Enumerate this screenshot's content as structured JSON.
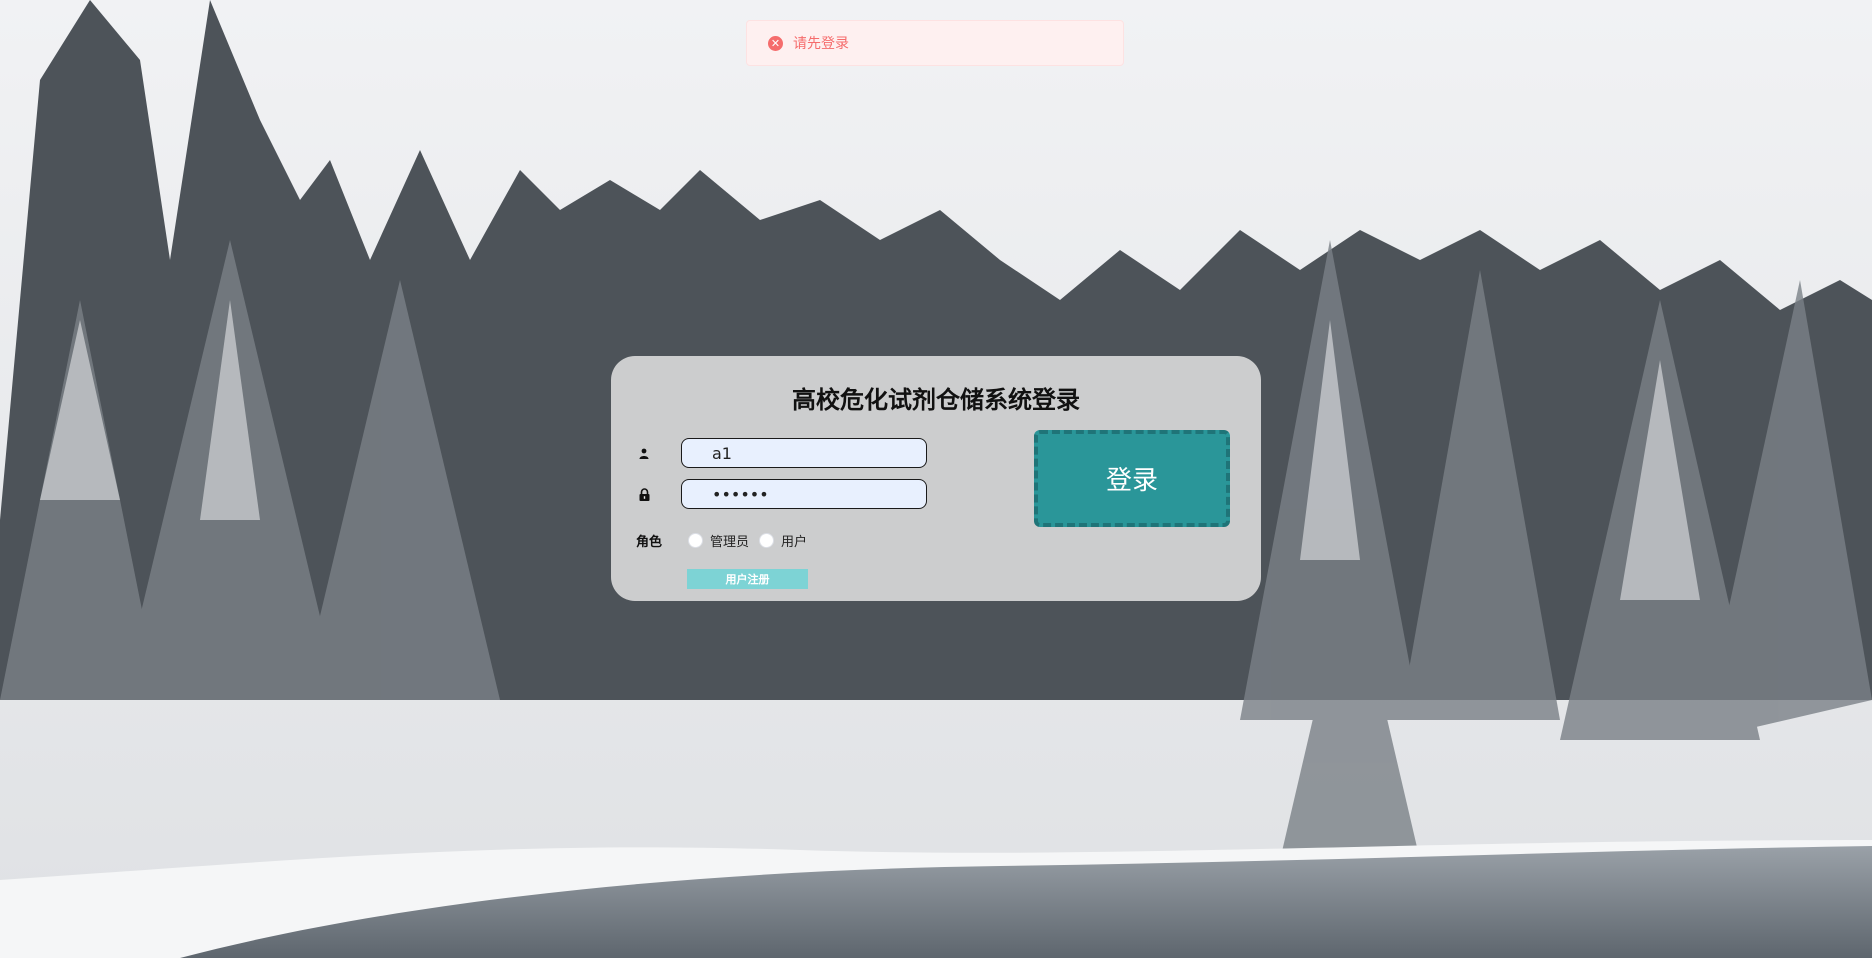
{
  "toast": {
    "icon": "error-circle-icon",
    "message": "请先登录",
    "color": "#f56c6c"
  },
  "login": {
    "title": "高校危化试剂仓储系统登录",
    "username_icon": "user-icon",
    "username_value": "a1",
    "password_icon": "lock-icon",
    "password_value": "••••••",
    "role_label": "角色",
    "roles": [
      "管理员",
      "用户"
    ],
    "register_label": "用户注册",
    "login_label": "登录",
    "accent": "#2a9699"
  }
}
